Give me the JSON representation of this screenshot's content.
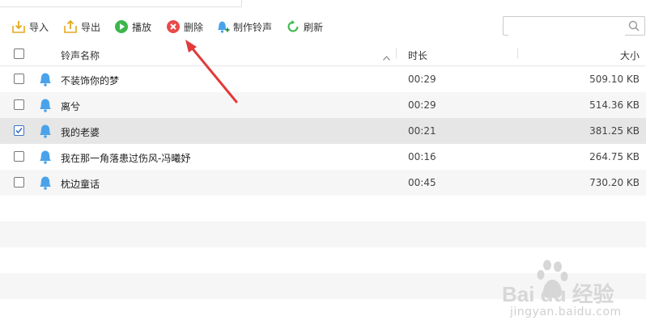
{
  "toolbar": {
    "import_label": "导入",
    "export_label": "导出",
    "play_label": "播放",
    "delete_label": "删除",
    "make_label": "制作铃声",
    "refresh_label": "刷新"
  },
  "search": {
    "placeholder": ""
  },
  "table": {
    "columns": {
      "name": "铃声名称",
      "duration": "时长",
      "size": "大小"
    },
    "rows": [
      {
        "name": "不装饰你的梦",
        "duration": "00:29",
        "size": "509.10 KB",
        "checked": false
      },
      {
        "name": "离兮",
        "duration": "00:29",
        "size": "514.36 KB",
        "checked": false
      },
      {
        "name": "我的老婆",
        "duration": "00:21",
        "size": "381.25 KB",
        "checked": true
      },
      {
        "name": "我在那一角落患过伤风-冯曦妤",
        "duration": "00:16",
        "size": "264.75 KB",
        "checked": false
      },
      {
        "name": "枕边童话",
        "duration": "00:45",
        "size": "730.20 KB",
        "checked": false
      }
    ]
  },
  "watermark": {
    "brand": "Bai du 经验",
    "url": "jingyan.baidu.com"
  },
  "colors": {
    "accent": "#3a73c4",
    "annotation_arrow": "#e23a3a",
    "bell": "#4aa3ea"
  }
}
